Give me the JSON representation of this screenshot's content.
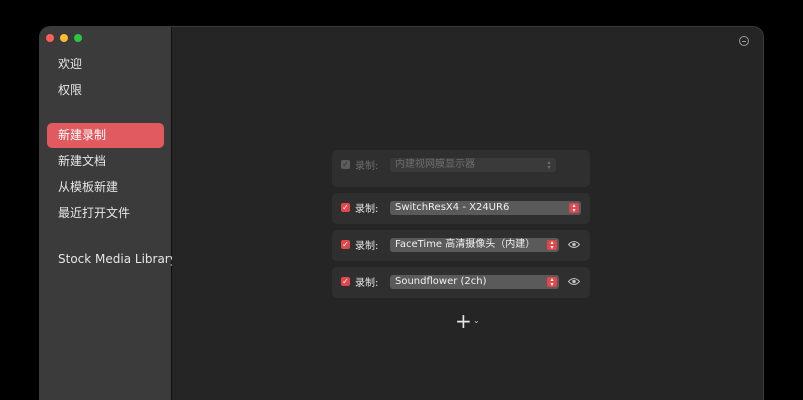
{
  "sidebar": {
    "items": [
      {
        "label": "欢迎",
        "active": false
      },
      {
        "label": "权限",
        "active": false
      },
      {
        "label": "新建录制",
        "active": true
      },
      {
        "label": "新建文档",
        "active": false
      },
      {
        "label": "从模板新建",
        "active": false
      },
      {
        "label": "最近打开文件",
        "active": false
      },
      {
        "label": "Stock Media Library",
        "active": false
      }
    ]
  },
  "recording": {
    "rows": [
      {
        "label": "录制:",
        "source": "内建视网膜显示器",
        "checked": true,
        "enabled": false,
        "has_eye": false
      },
      {
        "label": "录制:",
        "source": "SwitchResX4 - X24UR6",
        "checked": true,
        "enabled": true,
        "has_eye": false
      },
      {
        "label": "录制:",
        "source": "FaceTime 高清摄像头（内建）",
        "checked": true,
        "enabled": true,
        "has_eye": true
      },
      {
        "label": "录制:",
        "source": "Soundflower (2ch)",
        "checked": true,
        "enabled": true,
        "has_eye": true
      }
    ]
  },
  "icons": {
    "checkbox": "checkmark-icon",
    "select": "updown-chevron-icon",
    "preview": "eye-icon",
    "add": "plus-icon",
    "add_menu": "chevron-down-icon",
    "window_control": "minimize-circle-icon"
  },
  "colors": {
    "accent": "#e05a5f",
    "sidebar_bg": "#3b3b3b",
    "main_bg": "#252525",
    "card_bg": "#2f2f2f"
  }
}
